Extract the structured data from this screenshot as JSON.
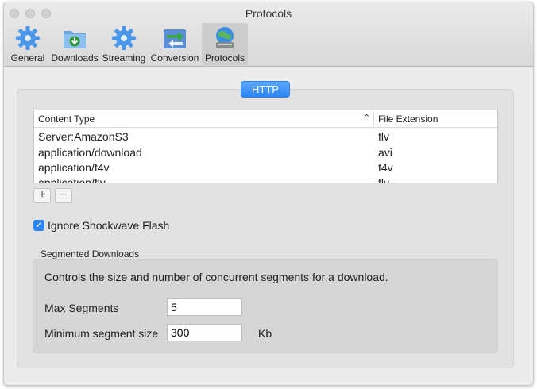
{
  "window": {
    "title": "Protocols"
  },
  "toolbar": {
    "items": [
      {
        "label": "General",
        "icon": "gear-icon"
      },
      {
        "label": "Downloads",
        "icon": "download-folder-icon"
      },
      {
        "label": "Streaming",
        "icon": "gear-icon"
      },
      {
        "label": "Conversion",
        "icon": "convert-arrows-icon"
      },
      {
        "label": "Protocols",
        "icon": "globe-network-icon",
        "selected": true
      }
    ]
  },
  "segment": {
    "label": "HTTP"
  },
  "table": {
    "columns": [
      "Content Type",
      "File Extension"
    ],
    "rows": [
      [
        "Server:AmazonS3",
        "flv"
      ],
      [
        "application/download",
        "avi"
      ],
      [
        "application/f4v",
        "f4v"
      ],
      [
        "application/flv",
        "flv"
      ]
    ]
  },
  "buttons": {
    "add": "+",
    "remove": "−"
  },
  "ignore_flash": {
    "label": "Ignore Shockwave Flash",
    "checked": true
  },
  "segmented": {
    "title": "Segmented Downloads",
    "description": "Controls the size and number of concurrent segments for a download.",
    "max_segments_label": "Max Segments",
    "max_segments_value": "5",
    "min_size_label": "Minimum segment size",
    "min_size_value": "300",
    "min_size_unit": "Kb"
  },
  "colors": {
    "accent": "#2f86f6"
  }
}
